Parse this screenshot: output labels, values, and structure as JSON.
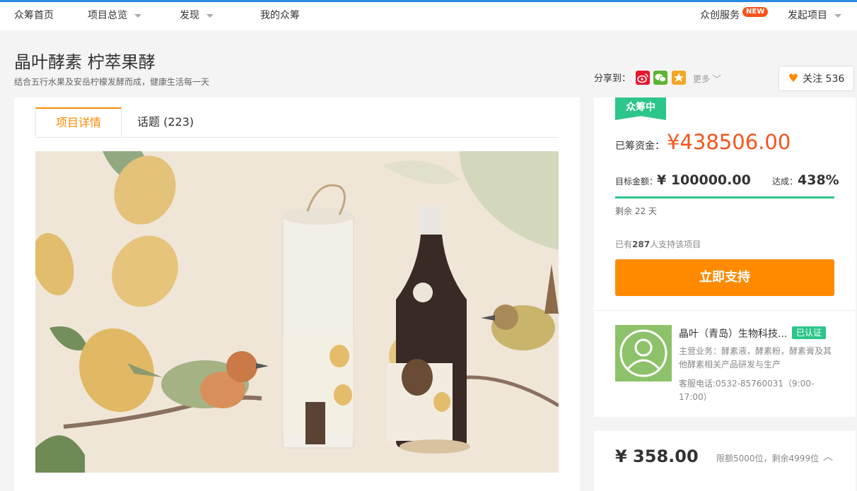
{
  "nav": {
    "home": "众筹首页",
    "overview": "项目总览",
    "discover": "发现",
    "my": "我的众筹",
    "services": "众创服务",
    "services_badge": "NEW",
    "launch": "发起项目"
  },
  "project": {
    "title": "晶叶酵素 柠萃果酵",
    "subtitle": "结合五行水果及安岳柠檬发酵而成，健康生活每一天"
  },
  "share": {
    "label": "分享到：",
    "more": "更多",
    "icons": [
      "weibo-icon",
      "wechat-icon",
      "qzone-icon"
    ]
  },
  "follow": {
    "label": "关注",
    "count": "536"
  },
  "tabs": [
    {
      "label": "项目详情"
    },
    {
      "label": "话题 (223)"
    }
  ],
  "funding": {
    "status_badge": "众筹中",
    "raised_label": "已筹资金：",
    "raised_value": "¥438506.00",
    "target_label": "目标金额：",
    "target_value": "¥ 100000.00",
    "reach_label": "达成：",
    "reach_value": "438%",
    "progress_fraction": 1.0,
    "remaining": "剩余 22 天",
    "supporters_prefix": "已有",
    "supporters_count": "287",
    "supporters_suffix": "人支持该项目",
    "support_button": "立即支持"
  },
  "company": {
    "name": "晶叶（青岛）生物科技...",
    "verified": "已认证",
    "business": "主营业务：酵素液，酵素粉，酵素膏及其他酵素相关产品研发与生产",
    "phone": "客服电话:0532-85760031（9:00-17:00）"
  },
  "reward": {
    "price": "¥ 358.00",
    "limit": "限额5000位，剩余4999位"
  },
  "colors": {
    "accent": "#ff8a00",
    "price_red": "#f5541d",
    "green": "#2cc58a"
  }
}
